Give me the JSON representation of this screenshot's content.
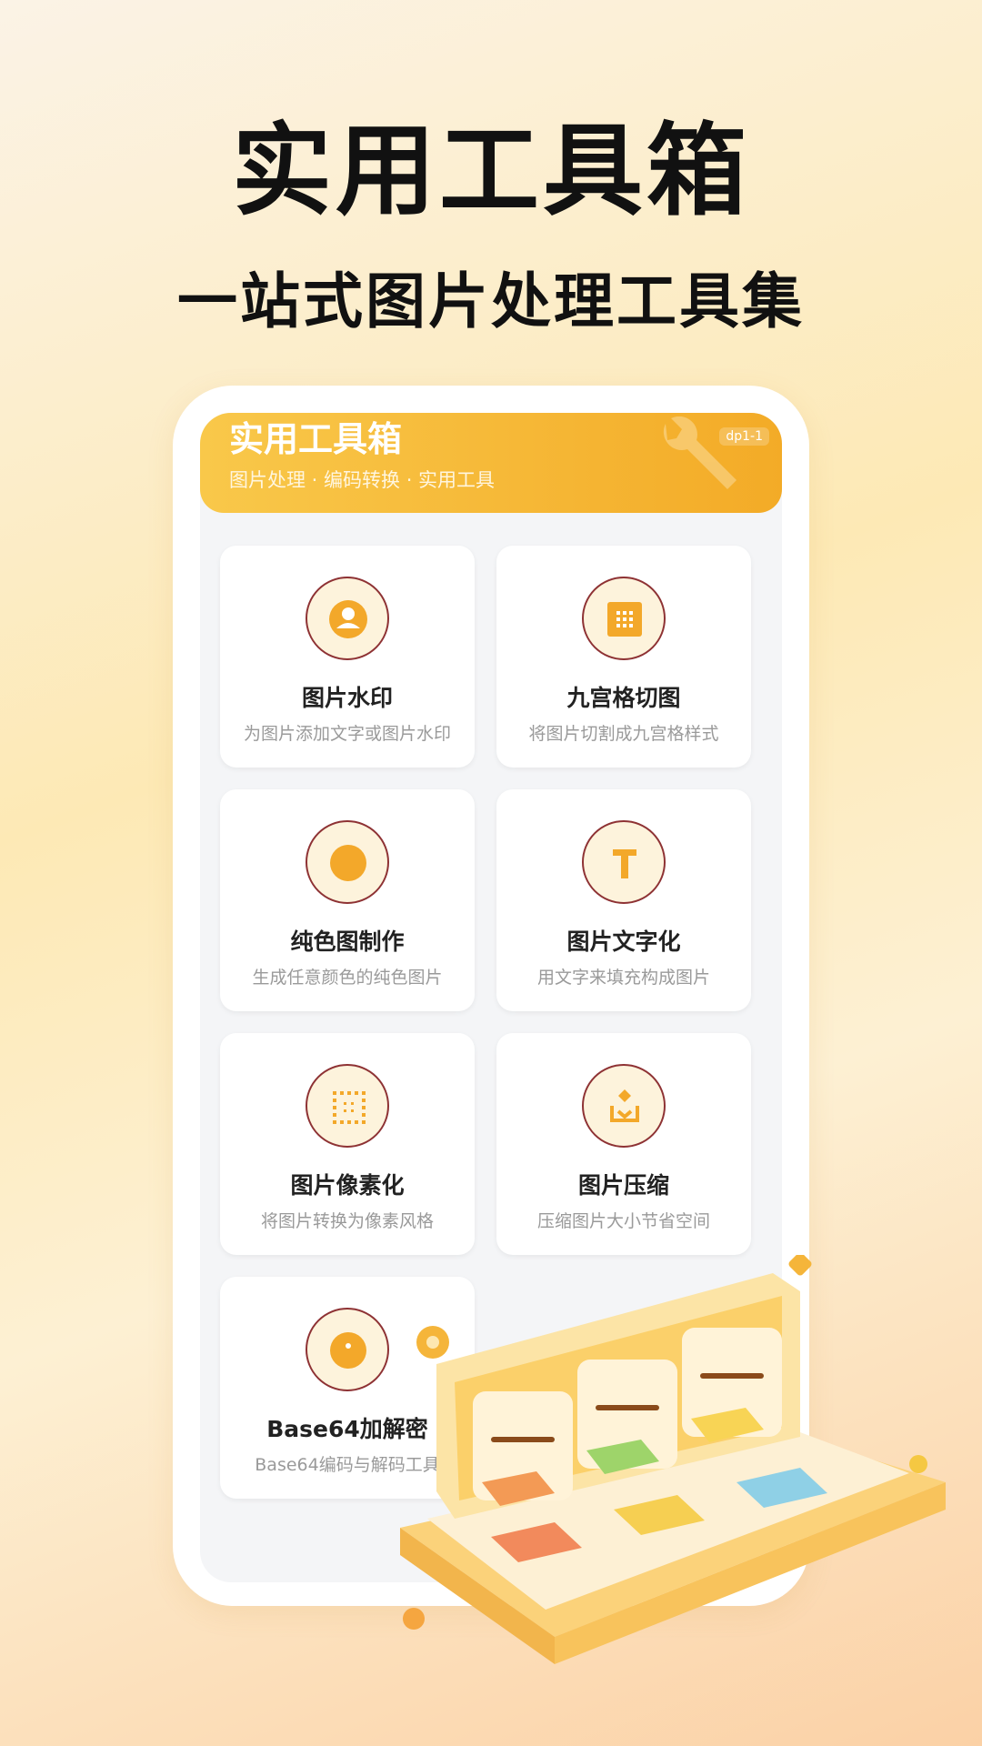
{
  "hero": {
    "title": "实用工具箱",
    "subtitle": "一站式图片处理工具集"
  },
  "app": {
    "banner": {
      "title": "实用工具箱",
      "subtitle": "图片处理 · 编码转换 · 实用工具",
      "badge": "dp1-1"
    },
    "tools": [
      {
        "title": "图片水印",
        "desc": "为图片添加文字或图片水印",
        "icon": "person-icon"
      },
      {
        "title": "九宫格切图",
        "desc": "将图片切割成九宫格样式",
        "icon": "grid-icon"
      },
      {
        "title": "纯色图制作",
        "desc": "生成任意颜色的纯色图片",
        "icon": "circle-icon"
      },
      {
        "title": "图片文字化",
        "desc": "用文字来填充构成图片",
        "icon": "text-icon"
      },
      {
        "title": "图片像素化",
        "desc": "将图片转换为像素风格",
        "icon": "pixel-icon"
      },
      {
        "title": "图片压缩",
        "desc": "压缩图片大小节省空间",
        "icon": "download-icon"
      },
      {
        "title": "Base64加解密",
        "desc": "Base64编码与解码工具",
        "icon": "dot-circle-icon"
      }
    ]
  },
  "colors": {
    "accent": "#f3a82a",
    "icon_border": "#8e3234",
    "icon_bg": "#fdf3dc"
  }
}
